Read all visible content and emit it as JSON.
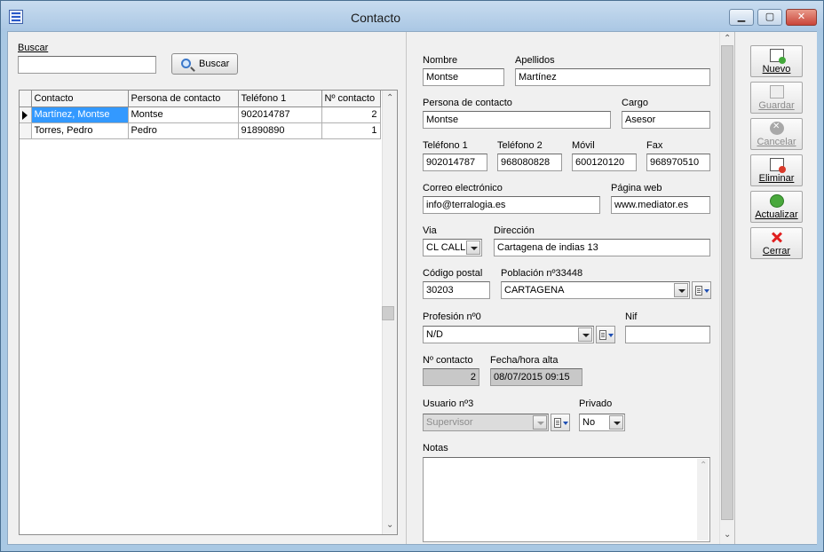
{
  "window": {
    "title": "Contacto"
  },
  "search": {
    "label": "Buscar",
    "value": "",
    "button": "Buscar"
  },
  "grid": {
    "columns": [
      "Contacto",
      "Persona de contacto",
      "Teléfono 1",
      "Nº contacto"
    ],
    "rows": [
      {
        "contacto": "Martínez, Montse",
        "persona": "Montse",
        "telefono": "902014787",
        "numero": "2"
      },
      {
        "contacto": "Torres, Pedro",
        "persona": "Pedro",
        "telefono": "91890890",
        "numero": "1"
      }
    ]
  },
  "form": {
    "nombre": {
      "label": "Nombre",
      "value": "Montse"
    },
    "apellidos": {
      "label": "Apellidos",
      "value": "Martínez"
    },
    "persona": {
      "label": "Persona de contacto",
      "value": "Montse"
    },
    "cargo": {
      "label": "Cargo",
      "value": "Asesor"
    },
    "tel1": {
      "label": "Teléfono 1",
      "value": "902014787"
    },
    "tel2": {
      "label": "Teléfono 2",
      "value": "968080828"
    },
    "movil": {
      "label": "Móvil",
      "value": "600120120"
    },
    "fax": {
      "label": "Fax",
      "value": "968970510"
    },
    "email": {
      "label": "Correo electrónico",
      "value": "info@terralogia.es"
    },
    "web": {
      "label": "Página web",
      "value": "www.mediator.es"
    },
    "via": {
      "label": "Via",
      "value": "CL CALLE"
    },
    "direccion": {
      "label": "Dirección",
      "value": "Cartagena de indias 13"
    },
    "cp": {
      "label": "Código postal",
      "value": "30203"
    },
    "poblacion": {
      "label": "Población nº33448",
      "value": "CARTAGENA"
    },
    "profesion": {
      "label": "Profesión nº0",
      "value": "N/D"
    },
    "nif": {
      "label": "Nif",
      "value": ""
    },
    "num_contacto": {
      "label": "Nº contacto",
      "value": "2"
    },
    "fecha_alta": {
      "label": "Fecha/hora alta",
      "value": "08/07/2015 09:15"
    },
    "usuario": {
      "label": "Usuario nº3",
      "value": "Supervisor"
    },
    "privado": {
      "label": "Privado",
      "value": "No"
    },
    "notas": {
      "label": "Notas",
      "value": ""
    }
  },
  "actions": {
    "nuevo": "Nuevo",
    "guardar": "Guardar",
    "cancelar": "Cancelar",
    "eliminar": "Eliminar",
    "actualizar": "Actualizar",
    "cerrar": "Cerrar"
  },
  "colors": {
    "selection": "#3399ff",
    "title_bar": "#aac7e4",
    "close_button": "#c9453a"
  }
}
